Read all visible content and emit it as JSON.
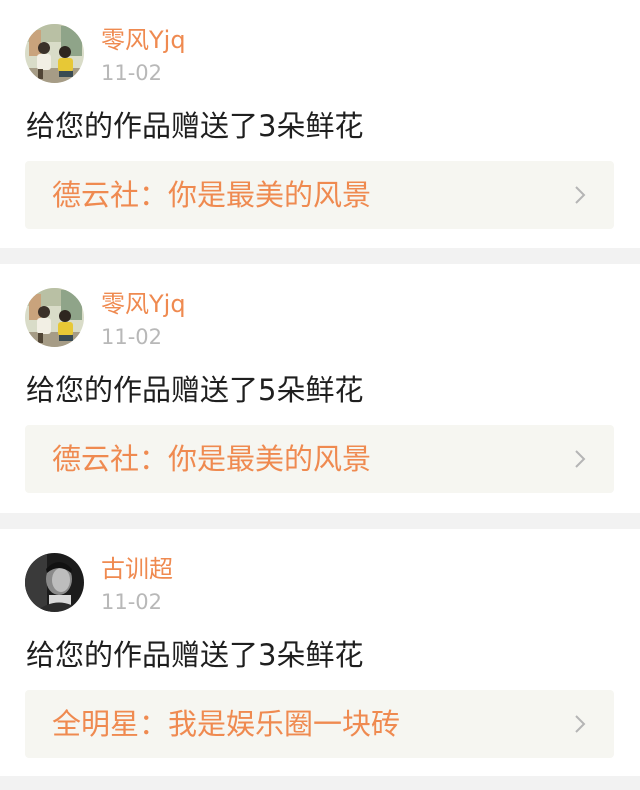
{
  "notifications": [
    {
      "user": "零风Yjq",
      "date": "11-02",
      "message": "给您的作品赠送了3朵鲜花",
      "work_title": "德云社：你是最美的风景",
      "avatar_icon": "user-photo-two-people"
    },
    {
      "user": "零风Yjq",
      "date": "11-02",
      "message": "给您的作品赠送了5朵鲜花",
      "work_title": "德云社：你是最美的风景",
      "avatar_icon": "user-photo-two-people"
    },
    {
      "user": "古训超",
      "date": "11-02",
      "message": "给您的作品赠送了3朵鲜花",
      "work_title": "全明星：我是娱乐圈一块砖",
      "avatar_icon": "user-photo-portrait-bw"
    }
  ],
  "colors": {
    "accent": "#ef8a50",
    "date": "#b8b8b8",
    "text": "#1f1f1f",
    "link_bg": "#f6f6f1",
    "page_bg": "#f2f2f2"
  }
}
